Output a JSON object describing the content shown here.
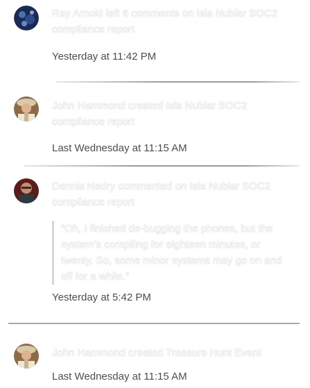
{
  "feed": {
    "items": [
      {
        "avatar": "ray-arnold-avatar",
        "text": "Ray Arnold left 6 comments on Isla Nublar SOC2 compliance report",
        "time": "Yesterday at 11:42 PM"
      },
      {
        "avatar": "john-hammond-avatar",
        "text": "John Hammond created Isla Nublar SOC2 compliance report",
        "time": "Last Wednesday at 11:15 AM"
      },
      {
        "avatar": "dennis-nedry-avatar",
        "text": "Dennis Nedry commented on Isla Nublar SOC2 compliance report",
        "quote": "“Oh, I finished de-bugging the phones, but the system’s compiling for eighteen minutes, or twenty.  So, some minor systems may go on and off for a while.”",
        "time": "Yesterday at 5:42 PM"
      },
      {
        "avatar": "john-hammond-avatar",
        "text": "John Hammond created Treasure Hunt Event",
        "time": "Last Wednesday at 11:15 AM"
      }
    ]
  }
}
